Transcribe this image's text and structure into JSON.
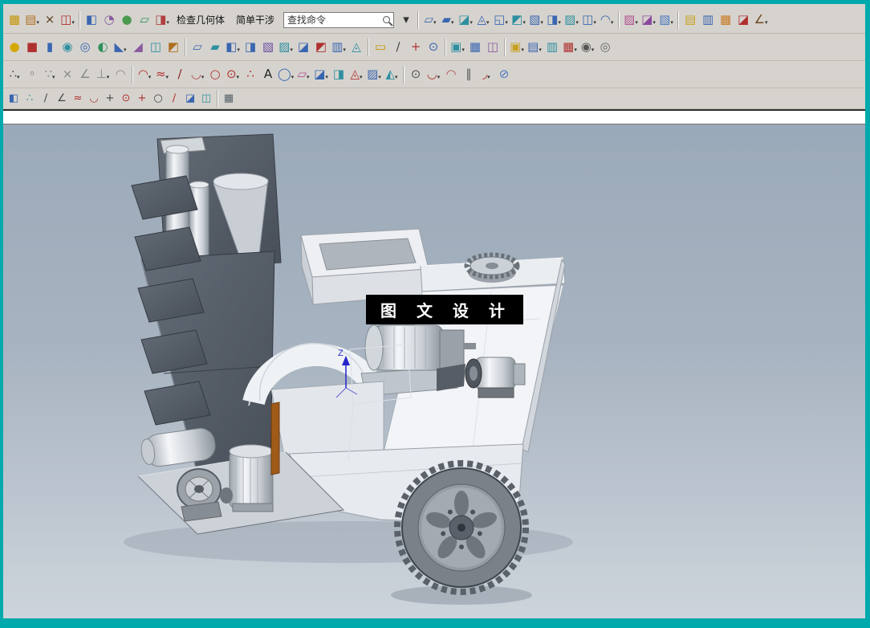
{
  "window": {
    "border_color": "#00AAAC",
    "toolbar_bg": "#D6D3CE"
  },
  "toolbar": {
    "rows": [
      [
        {
          "t": "icon",
          "n": "direct-sketch-icon",
          "g": "▦",
          "c": "#C49400"
        },
        {
          "t": "icon",
          "n": "sketch-curve-icon",
          "g": "▤",
          "c": "#B07020",
          "a": true
        },
        {
          "t": "icon",
          "n": "delete-icon",
          "g": "×",
          "c": "#5A4020"
        },
        {
          "t": "icon",
          "n": "pattern-feature-icon",
          "g": "◫",
          "c": "#B03030",
          "a": true
        },
        {
          "t": "sep"
        },
        {
          "t": "icon",
          "n": "extrude-icon",
          "g": "◧",
          "c": "#3A66B0"
        },
        {
          "t": "icon",
          "n": "revolve-icon",
          "g": "◔",
          "c": "#8A5AA0"
        },
        {
          "t": "icon",
          "n": "sphere-feature-icon",
          "g": "●",
          "c": "#4A9A50"
        },
        {
          "t": "icon",
          "n": "sheet-body-icon",
          "g": "▱",
          "c": "#2E8F5A"
        },
        {
          "t": "icon",
          "n": "more-features-icon",
          "g": "◨",
          "c": "#B04040",
          "a": true
        },
        {
          "t": "label",
          "n": "check-geometry-button",
          "text": "检查几何体"
        },
        {
          "t": "label",
          "n": "simple-interference-button",
          "text": "简单干涉"
        },
        {
          "t": "search",
          "n": "find-command-search",
          "placeholder": "查找命令"
        },
        {
          "t": "icon",
          "n": "search-options-icon",
          "g": "▾",
          "c": "#333"
        },
        {
          "t": "sep"
        },
        {
          "t": "icon",
          "n": "through-curves-icon",
          "g": "▱",
          "c": "#3A66B0",
          "a": true
        },
        {
          "t": "icon",
          "n": "ruled-surface-icon",
          "g": "▰",
          "c": "#3A66B0",
          "a": true
        },
        {
          "t": "icon",
          "n": "swept-surface-icon",
          "g": "◪",
          "c": "#2E8FA0",
          "a": true
        },
        {
          "t": "icon",
          "n": "n-sided-surface-icon",
          "g": "◬",
          "c": "#3A66B0",
          "a": true
        },
        {
          "t": "icon",
          "n": "bounded-plane-icon",
          "g": "◱",
          "c": "#3A66B0",
          "a": true
        },
        {
          "t": "icon",
          "n": "fill-surface-icon",
          "g": "◩",
          "c": "#2E8FA0",
          "a": true
        },
        {
          "t": "icon",
          "n": "offset-surface-icon",
          "g": "▧",
          "c": "#3A66B0",
          "a": true
        },
        {
          "t": "icon",
          "n": "trimmed-sheet-icon",
          "g": "◨",
          "c": "#3A66B0",
          "a": true
        },
        {
          "t": "icon",
          "n": "extension-surface-icon",
          "g": "▨",
          "c": "#2E8FA0",
          "a": true
        },
        {
          "t": "icon",
          "n": "law-extension-icon",
          "g": "◫",
          "c": "#3A66B0",
          "a": true
        },
        {
          "t": "icon",
          "n": "blend-surface-icon",
          "g": "◠",
          "c": "#3A66B0",
          "a": true
        },
        {
          "t": "sep"
        },
        {
          "t": "icon",
          "n": "x-form-icon",
          "g": "▨",
          "c": "#B05090",
          "a": true
        },
        {
          "t": "icon",
          "n": "i-form-icon",
          "g": "◪",
          "c": "#8A4AA0",
          "a": true
        },
        {
          "t": "icon",
          "n": "edge-symmetry-icon",
          "g": "▧",
          "c": "#4A78C0",
          "a": true
        },
        {
          "t": "sep"
        },
        {
          "t": "icon",
          "n": "copy-display-icon",
          "g": "▤",
          "c": "#C8A020"
        },
        {
          "t": "icon",
          "n": "paste-icon",
          "g": "▥",
          "c": "#3A66B0"
        },
        {
          "t": "icon",
          "n": "export-pdf-icon",
          "g": "▦",
          "c": "#C87820"
        },
        {
          "t": "icon",
          "n": "notes-icon",
          "g": "◪",
          "c": "#B03030"
        },
        {
          "t": "icon",
          "n": "measure-icon",
          "g": "∠",
          "c": "#70451E",
          "a": true
        }
      ],
      [
        {
          "t": "icon",
          "n": "sphere-primitive-icon",
          "g": "●",
          "c": "#D4A800"
        },
        {
          "t": "icon",
          "n": "block-primitive-icon",
          "g": "■",
          "c": "#B03030"
        },
        {
          "t": "icon",
          "n": "cylinder-primitive-icon",
          "g": "▮",
          "c": "#3A66B0"
        },
        {
          "t": "icon",
          "n": "unite-icon",
          "g": "◉",
          "c": "#2E8FA0"
        },
        {
          "t": "icon",
          "n": "subtract-icon",
          "g": "◎",
          "c": "#3A66B0"
        },
        {
          "t": "icon",
          "n": "intersect-icon",
          "g": "◐",
          "c": "#2E8F5A"
        },
        {
          "t": "icon",
          "n": "edge-blend-icon",
          "g": "◣",
          "c": "#3A66B0",
          "a": true
        },
        {
          "t": "icon",
          "n": "chamfer-icon",
          "g": "◢",
          "c": "#8A5AA0"
        },
        {
          "t": "icon",
          "n": "shell-icon",
          "g": "◫",
          "c": "#2E8FA0"
        },
        {
          "t": "icon",
          "n": "draft-icon",
          "g": "◩",
          "c": "#B07020"
        },
        {
          "t": "sep"
        },
        {
          "t": "icon",
          "n": "thicken-icon",
          "g": "▱",
          "c": "#3A66B0"
        },
        {
          "t": "icon",
          "n": "sheet-to-solid-icon",
          "g": "▰",
          "c": "#2E8FA0"
        },
        {
          "t": "icon",
          "n": "patch-icon",
          "g": "◧",
          "c": "#3A66B0",
          "a": true
        },
        {
          "t": "icon",
          "n": "sew-icon",
          "g": "◨",
          "c": "#3A66B0"
        },
        {
          "t": "icon",
          "n": "unsew-icon",
          "g": "▧",
          "c": "#6A4AA0"
        },
        {
          "t": "icon",
          "n": "offset-face-icon",
          "g": "▨",
          "c": "#2E8FA0",
          "a": true
        },
        {
          "t": "icon",
          "n": "scale-body-icon",
          "g": "◪",
          "c": "#3A66B0"
        },
        {
          "t": "icon",
          "n": "trim-body-icon",
          "g": "◩",
          "c": "#B03030"
        },
        {
          "t": "icon",
          "n": "split-body-icon",
          "g": "▥",
          "c": "#3A66B0",
          "a": true
        },
        {
          "t": "icon",
          "n": "wrap-geometry-icon",
          "g": "◬",
          "c": "#2E8FA0"
        },
        {
          "t": "sep"
        },
        {
          "t": "icon",
          "n": "datum-plane-icon",
          "g": "▭",
          "c": "#C49400"
        },
        {
          "t": "icon",
          "n": "datum-axis-icon",
          "g": "∕",
          "c": "#444444"
        },
        {
          "t": "icon",
          "n": "datum-csys-icon",
          "g": "+",
          "c": "#B03030"
        },
        {
          "t": "icon",
          "n": "point-feature-icon",
          "g": "⊙",
          "c": "#3A66B0"
        },
        {
          "t": "sep"
        },
        {
          "t": "icon",
          "n": "move-object-icon",
          "g": "▣",
          "c": "#2E8FA0",
          "a": true
        },
        {
          "t": "icon",
          "n": "pattern-geometry-icon",
          "g": "▦",
          "c": "#3A66B0"
        },
        {
          "t": "icon",
          "n": "mirror-geometry-icon",
          "g": "◫",
          "c": "#8A5AA0"
        },
        {
          "t": "sep"
        },
        {
          "t": "icon",
          "n": "synchronous-move-face-icon",
          "g": "▣",
          "c": "#C8A020",
          "a": true
        },
        {
          "t": "icon",
          "n": "pull-face-icon",
          "g": "▤",
          "c": "#3A66B0",
          "a": true
        },
        {
          "t": "icon",
          "n": "replace-face-icon",
          "g": "▥",
          "c": "#2E8FA0"
        },
        {
          "t": "icon",
          "n": "delete-face-icon",
          "g": "▦",
          "c": "#B03030",
          "a": true
        },
        {
          "t": "icon",
          "n": "resize-face-icon",
          "g": "◉",
          "c": "#555555",
          "a": true
        },
        {
          "t": "icon",
          "n": "analysis-gear-icon",
          "g": "◎",
          "c": "#666666"
        }
      ],
      [
        {
          "t": "icon",
          "n": "snap-point-icon",
          "g": "∴",
          "c": "#555555",
          "a": true
        },
        {
          "t": "icon",
          "n": "snap-endpoint-icon",
          "g": "◦",
          "c": "#555555"
        },
        {
          "t": "icon",
          "n": "snap-midpoint-icon",
          "g": "∵",
          "c": "#888888",
          "a": true
        },
        {
          "t": "icon",
          "n": "snap-intersection-icon",
          "g": "×",
          "c": "#888888"
        },
        {
          "t": "icon",
          "n": "snap-angle-icon",
          "g": "∠",
          "c": "#888888"
        },
        {
          "t": "icon",
          "n": "snap-perpendicular-icon",
          "g": "⊥",
          "c": "#888888",
          "a": true
        },
        {
          "t": "icon",
          "n": "snap-tangent-icon",
          "g": "◠",
          "c": "#888888"
        },
        {
          "t": "sep"
        },
        {
          "t": "icon",
          "n": "profile-icon",
          "g": "◠",
          "c": "#B03030",
          "a": true
        },
        {
          "t": "icon",
          "n": "studio-spline-icon",
          "g": "≈",
          "c": "#B03030",
          "a": true
        },
        {
          "t": "icon",
          "n": "line-tool-icon",
          "g": "∕",
          "c": "#8A2020"
        },
        {
          "t": "icon",
          "n": "arc-tool-icon",
          "g": "◡",
          "c": "#B05050",
          "a": true
        },
        {
          "t": "icon",
          "n": "circle-tool-icon",
          "g": "○",
          "c": "#B03030"
        },
        {
          "t": "icon",
          "n": "point-tool-icon",
          "g": "⊙",
          "c": "#B03030",
          "a": true
        },
        {
          "t": "icon",
          "n": "point-set-icon",
          "g": "∴",
          "c": "#B03030"
        },
        {
          "t": "icon",
          "n": "text-tool-icon",
          "g": "A",
          "c": "#222222"
        },
        {
          "t": "icon",
          "n": "oval-tool-icon",
          "g": "◯",
          "c": "#3A66B0",
          "a": true
        },
        {
          "t": "icon",
          "n": "surface-curve-icon",
          "g": "▱",
          "c": "#B05090",
          "a": true
        },
        {
          "t": "icon",
          "n": "intersection-curve-icon",
          "g": "◪",
          "c": "#3A66B0",
          "a": true
        },
        {
          "t": "icon",
          "n": "section-curve-icon",
          "g": "◨",
          "c": "#2E8FA0"
        },
        {
          "t": "icon",
          "n": "heart-curve-icon",
          "g": "◬",
          "c": "#B03030",
          "a": true
        },
        {
          "t": "icon",
          "n": "project-curve-icon",
          "g": "▨",
          "c": "#3A66B0",
          "a": true
        },
        {
          "t": "icon",
          "n": "combine-curve-icon",
          "g": "◭",
          "c": "#2E8FA0",
          "a": true
        },
        {
          "t": "sep"
        },
        {
          "t": "icon",
          "n": "point2-icon",
          "g": "⊙",
          "c": "#555555"
        },
        {
          "t": "icon",
          "n": "curve-length-icon",
          "g": "◡",
          "c": "#B03030",
          "a": true
        },
        {
          "t": "icon",
          "n": "bridge-curve-icon",
          "g": "◠",
          "c": "#B05050"
        },
        {
          "t": "icon",
          "n": "offset-curve-icon",
          "g": "∥",
          "c": "#555555"
        },
        {
          "t": "icon",
          "n": "smooth-curve-icon",
          "g": "◞",
          "c": "#B03030",
          "a": true
        },
        {
          "t": "icon",
          "n": "trim-curve-icon",
          "g": "⊘",
          "c": "#4A78C0"
        }
      ],
      [
        {
          "t": "icon",
          "n": "wave-link-icon",
          "g": "◧",
          "c": "#3A66B0"
        },
        {
          "t": "icon",
          "n": "point-cloud-icon",
          "g": "∴",
          "c": "#2E8FA0"
        },
        {
          "t": "icon",
          "n": "sketch-line-icon",
          "g": "∕",
          "c": "#444444"
        },
        {
          "t": "icon",
          "n": "sketch-polyline-icon",
          "g": "∠",
          "c": "#444444"
        },
        {
          "t": "icon",
          "n": "spline-fit-icon",
          "g": "≈",
          "c": "#B03030"
        },
        {
          "t": "icon",
          "n": "curve-arc-icon",
          "g": "◡",
          "c": "#B03030"
        },
        {
          "t": "icon",
          "n": "axis-cross-icon",
          "g": "+",
          "c": "#444444"
        },
        {
          "t": "icon",
          "n": "circle-center-icon",
          "g": "⊙",
          "c": "#B03030"
        },
        {
          "t": "icon",
          "n": "plus-point-icon",
          "g": "+",
          "c": "#B03030"
        },
        {
          "t": "icon",
          "n": "circle-outline-icon",
          "g": "○",
          "c": "#444444"
        },
        {
          "t": "icon",
          "n": "diagonal-line-icon",
          "g": "∕",
          "c": "#B03030"
        },
        {
          "t": "icon",
          "n": "surface-patch-icon",
          "g": "◪",
          "c": "#3A66B0"
        },
        {
          "t": "icon",
          "n": "layer-visible-icon",
          "g": "◫",
          "c": "#2E8FA0"
        },
        {
          "t": "sep"
        },
        {
          "t": "icon",
          "n": "part-navigator-table-icon",
          "g": "▦",
          "c": "#55606A"
        }
      ]
    ]
  },
  "status_bar": {
    "text": ""
  },
  "viewport": {
    "watermark": "图 文 设 计",
    "z_axis_label": "Z",
    "background_top": "#9AA9B9",
    "background_bottom": "#CDD4DB"
  }
}
